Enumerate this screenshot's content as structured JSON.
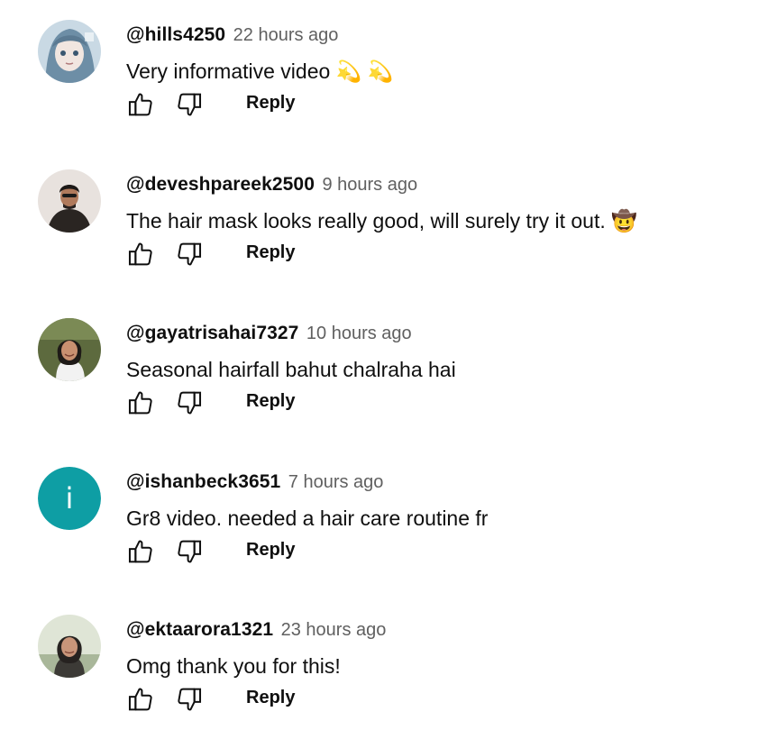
{
  "comments": [
    {
      "author": "@hills4250",
      "time": "22 hours ago",
      "text": "Very informative video 💫 💫",
      "reply_label": "Reply",
      "avatar": {
        "type": "anime",
        "colors": [
          "#c9d9e4",
          "#6d8ea6",
          "#f1e6e0"
        ]
      }
    },
    {
      "author": "@deveshpareek2500",
      "time": "9 hours ago",
      "text": "The hair mask looks really good, will surely try it out. 🤠",
      "reply_label": "Reply",
      "avatar": {
        "type": "photo",
        "colors": [
          "#e8e2de",
          "#2a2522",
          "#b07a5c"
        ]
      }
    },
    {
      "author": "@gayatrisahai7327",
      "time": "10 hours ago",
      "text": "Seasonal hairfall bahut chalraha hai",
      "reply_label": "Reply",
      "avatar": {
        "type": "photo",
        "colors": [
          "#5d6a3e",
          "#1e1a17",
          "#c99070"
        ]
      }
    },
    {
      "author": "@ishanbeck3651",
      "time": "7 hours ago",
      "text": "Gr8 video. needed a hair care routine fr",
      "reply_label": "Reply",
      "avatar": {
        "type": "letter",
        "letter": "i",
        "color": "#0e9ea4"
      }
    },
    {
      "author": "@ektaarora1321",
      "time": "23 hours ago",
      "text": "Omg thank you for this!",
      "reply_label": "Reply",
      "avatar": {
        "type": "photo",
        "colors": [
          "#dfe5d6",
          "#262220",
          "#c8957a"
        ]
      }
    }
  ],
  "icons": {
    "like": "thumbs-up-icon",
    "dislike": "thumbs-down-icon"
  }
}
